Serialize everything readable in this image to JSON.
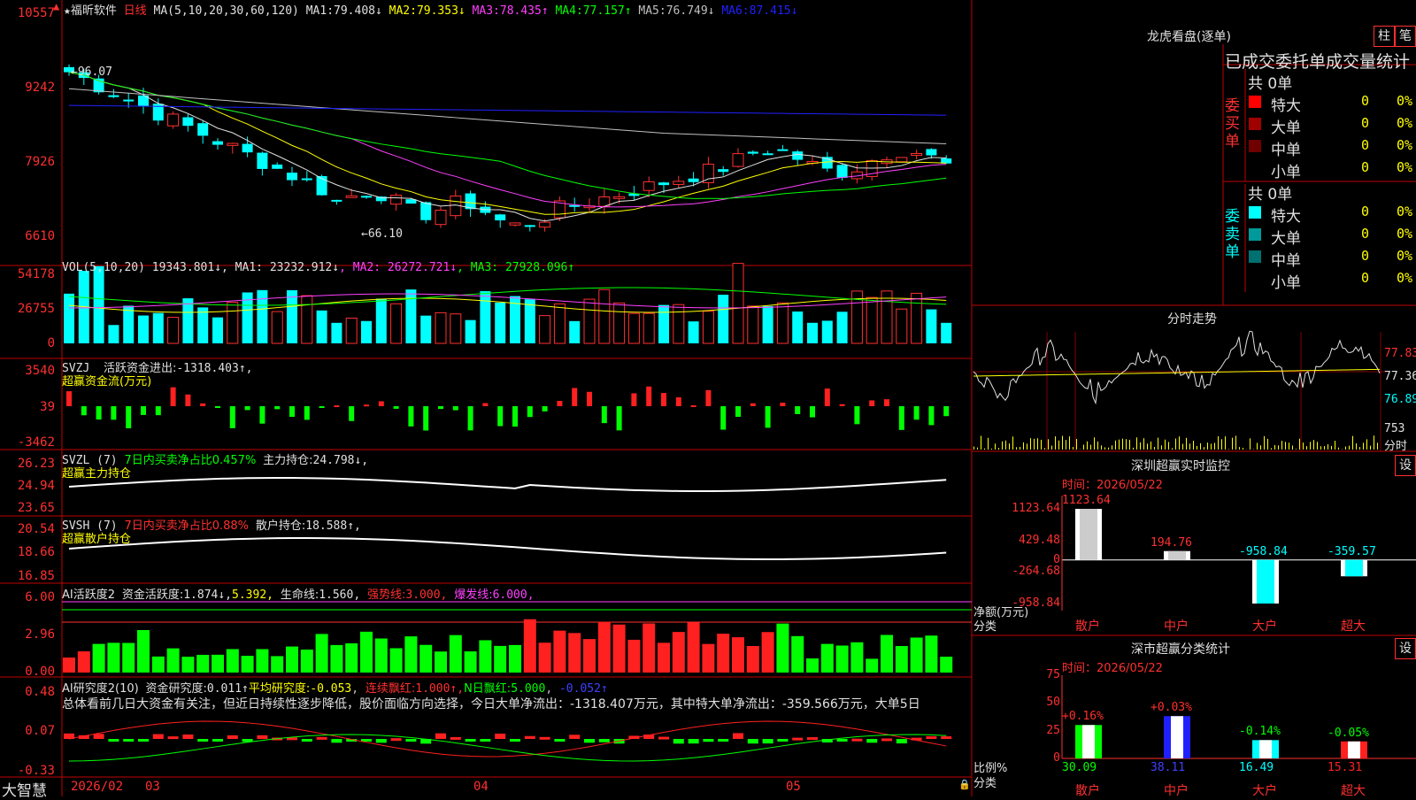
{
  "stock": {
    "name": "福昕软件",
    "period": "日线"
  },
  "main": {
    "ma_title": "MA(5,10,20,30,60,120)",
    "ma": [
      {
        "label": "MA1:",
        "value": "79.408",
        "arrow": "↓",
        "color": "#e0e0e0"
      },
      {
        "label": "MA2:",
        "value": "79.353",
        "arrow": "↓",
        "color": "#ffff00"
      },
      {
        "label": "MA3:",
        "value": "78.435",
        "arrow": "↑",
        "color": "#ff40ff"
      },
      {
        "label": "MA4:",
        "value": "77.157",
        "arrow": "↑",
        "color": "#00ff00"
      },
      {
        "label": "MA5:",
        "value": "76.749",
        "arrow": "↓",
        "color": "#c0c0c0"
      },
      {
        "label": "MA6:",
        "value": "87.415",
        "arrow": "↓",
        "color": "#2020ff"
      }
    ],
    "ticks": [
      "10557",
      "9242",
      "7926",
      "6610"
    ],
    "high_mark": "96.07",
    "low_mark": "66.10"
  },
  "vol": {
    "title": "VOL(5,10,20)",
    "value": "19343.801",
    "arrow": "↓",
    "ma": [
      {
        "label": "MA1:",
        "value": "23232.912",
        "arrow": "↓",
        "color": "#e0e0e0"
      },
      {
        "label": "MA2:",
        "value": "26272.721",
        "arrow": "↓",
        "color": "#ff40ff"
      },
      {
        "label": "MA3:",
        "value": "27928.096",
        "arrow": "↑",
        "color": "#00ff00"
      }
    ],
    "ticks": [
      "54178",
      "26755",
      "0"
    ]
  },
  "svzj": {
    "title": "SVZJ",
    "desc": "活跃资金进出:",
    "value": "-1318.403",
    "arrow": "↑,",
    "sub": "超赢资金流(万元)",
    "ticks": [
      "3540",
      "39",
      "-3462"
    ]
  },
  "svzl": {
    "title": "SVZL (7)",
    "desc": "7日内买卖净占比0.457%",
    "desc2": "主力持仓:",
    "value": "24.798",
    "arrow": "↓,",
    "sub": "超赢主力持仓",
    "ticks": [
      "26.23",
      "24.94",
      "23.65"
    ]
  },
  "svsh": {
    "title": "SVSH (7)",
    "desc": "7日内买卖净占比0.88%",
    "desc2": "散户持仓:",
    "value": "18.588",
    "arrow": "↑,",
    "sub": "超赢散户持仓",
    "ticks": [
      "20.54",
      "18.66",
      "16.85"
    ]
  },
  "ai1": {
    "title": "AI活跃度2",
    "desc": "资金活跃度:",
    "value": "1.874",
    "arrow": "↓,",
    "v2": "5.392,",
    "life": "生命线:",
    "lifev": "1.560,",
    "strong": "强势线:",
    "strongv": "3.000,",
    "burst": "爆发线:",
    "burstv": "6.000,",
    "ticks": [
      "6.00",
      "2.96",
      "0.00"
    ]
  },
  "ai2": {
    "title": "AI研究度2(10)",
    "desc": "资金研究度:",
    "value": "0.011",
    "arrow": "↑",
    "avg": "平均研究度:",
    "avgv": "-0.053",
    "c1": "连续飘红:",
    "c1v": "1.000",
    "c2": "N日飘红:",
    "c2v": "5.000",
    "c3v": "-0.052",
    "ticks": [
      "0.48",
      "0.07",
      "-0.33"
    ],
    "comment": "总体看前几日大资金有关注，但近日持续性逐步降低，股价面临方向选择，今日大单净流出：-1318.407万元，其中特大单净流出：-359.566万元，大单5日"
  },
  "dates": {
    "brand": "大智慧",
    "d1": "2026/02",
    "d2": "03",
    "d3": "04",
    "d4": "05"
  },
  "longhu": {
    "title": "龙虎看盘(逐单)",
    "btn1": "柱",
    "btn2": "笔",
    "tabs": [
      "已成交",
      "委托单",
      "成交量统计"
    ],
    "buy": {
      "side": "委买单",
      "total": "共 0单",
      "rows": [
        {
          "name": "特大",
          "n": "0",
          "p": "0%",
          "color": "#ff0000"
        },
        {
          "name": "大单",
          "n": "0",
          "p": "0%",
          "color": "#a00000"
        },
        {
          "name": "中单",
          "n": "0",
          "p": "0%",
          "color": "#700000"
        },
        {
          "name": "小单",
          "n": "0",
          "p": "0%",
          "color": ""
        }
      ]
    },
    "sell": {
      "side": "委卖单",
      "total": "共 0单",
      "rows": [
        {
          "name": "特大",
          "n": "0",
          "p": "0%",
          "color": "#00ffff"
        },
        {
          "name": "大单",
          "n": "0",
          "p": "0%",
          "color": "#009a9a"
        },
        {
          "name": "中单",
          "n": "0",
          "p": "0%",
          "color": "#007070"
        },
        {
          "name": "小单",
          "n": "0",
          "p": "0%",
          "color": ""
        }
      ]
    }
  },
  "intraday": {
    "title": "分时走势",
    "ticks": [
      "77.83",
      "77.36",
      "76.89"
    ],
    "vol": "753",
    "unit": "分时"
  },
  "monitor": {
    "title": "深圳超赢实时监控",
    "btn": "设",
    "time": "时间：2026/05/22",
    "ylabel": "净额(万元)",
    "xlabel": "分类",
    "ticks": [
      "1123.64",
      "429.48",
      "0",
      "-264.68",
      "-958.84"
    ],
    "cats": [
      "散户",
      "中户",
      "大户",
      "超大"
    ],
    "values": [
      "1123.64",
      "194.76",
      "-958.84",
      "-359.57"
    ]
  },
  "classify": {
    "title": "深市超赢分类统计",
    "btn": "设",
    "time": "时间：2026/05/22",
    "ylabel": "比例%",
    "xlabel": "分类",
    "ticks": [
      "75",
      "50",
      "25",
      "0"
    ],
    "cats": [
      "散户",
      "中户",
      "大户",
      "超大"
    ],
    "values": [
      "30.09",
      "38.11",
      "16.49",
      "15.31"
    ],
    "changes": [
      "+0.16%",
      "+0.03%",
      "-0.14%",
      "-0.05%"
    ]
  },
  "chart_data": {
    "type": "bar",
    "title": "深圳超赢实时监控",
    "categories": [
      "散户",
      "中户",
      "大户",
      "超大"
    ],
    "series": [
      {
        "name": "净额(万元)",
        "values": [
          1123.64,
          194.76,
          -958.84,
          -359.57
        ]
      }
    ],
    "ylabel": "净额(万元)",
    "ylim": [
      -958.84,
      1123.64
    ]
  }
}
